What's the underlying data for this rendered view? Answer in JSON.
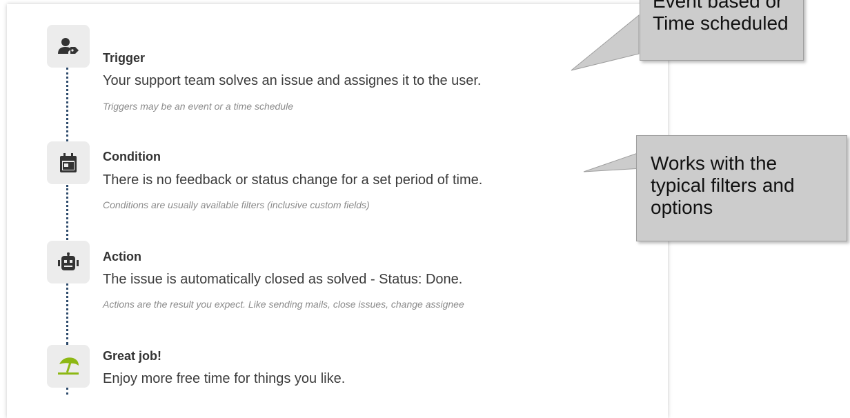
{
  "steps": [
    {
      "icon": "user-tag-icon",
      "title": "Trigger",
      "description": "Your support team solves an issue and assignes it to the user.",
      "hint": "Triggers may be an event or a time schedule"
    },
    {
      "icon": "calendar-icon",
      "title": "Condition",
      "description": "There is no feedback or status change for a set period of time.",
      "hint": "Conditions are usually available filters (inclusive custom fields)"
    },
    {
      "icon": "robot-icon",
      "title": "Action",
      "description": "The issue is automatically closed as solved - Status: Done.",
      "hint": "Actions are the result you expect. Like sending mails, close issues, change assignee"
    },
    {
      "icon": "beach-umbrella-icon",
      "title": "Great job!",
      "description": "Enjoy more free time for things you like."
    }
  ],
  "callouts": {
    "trigger": [
      "Event based or",
      "Time scheduled"
    ],
    "condition": [
      "Works with the",
      "typical filters and",
      "options"
    ]
  },
  "colors": {
    "icon_dark": "#333333",
    "icon_accent": "#8db814",
    "connector": "#2d4a6b",
    "callout_bg": "#cccccc"
  }
}
